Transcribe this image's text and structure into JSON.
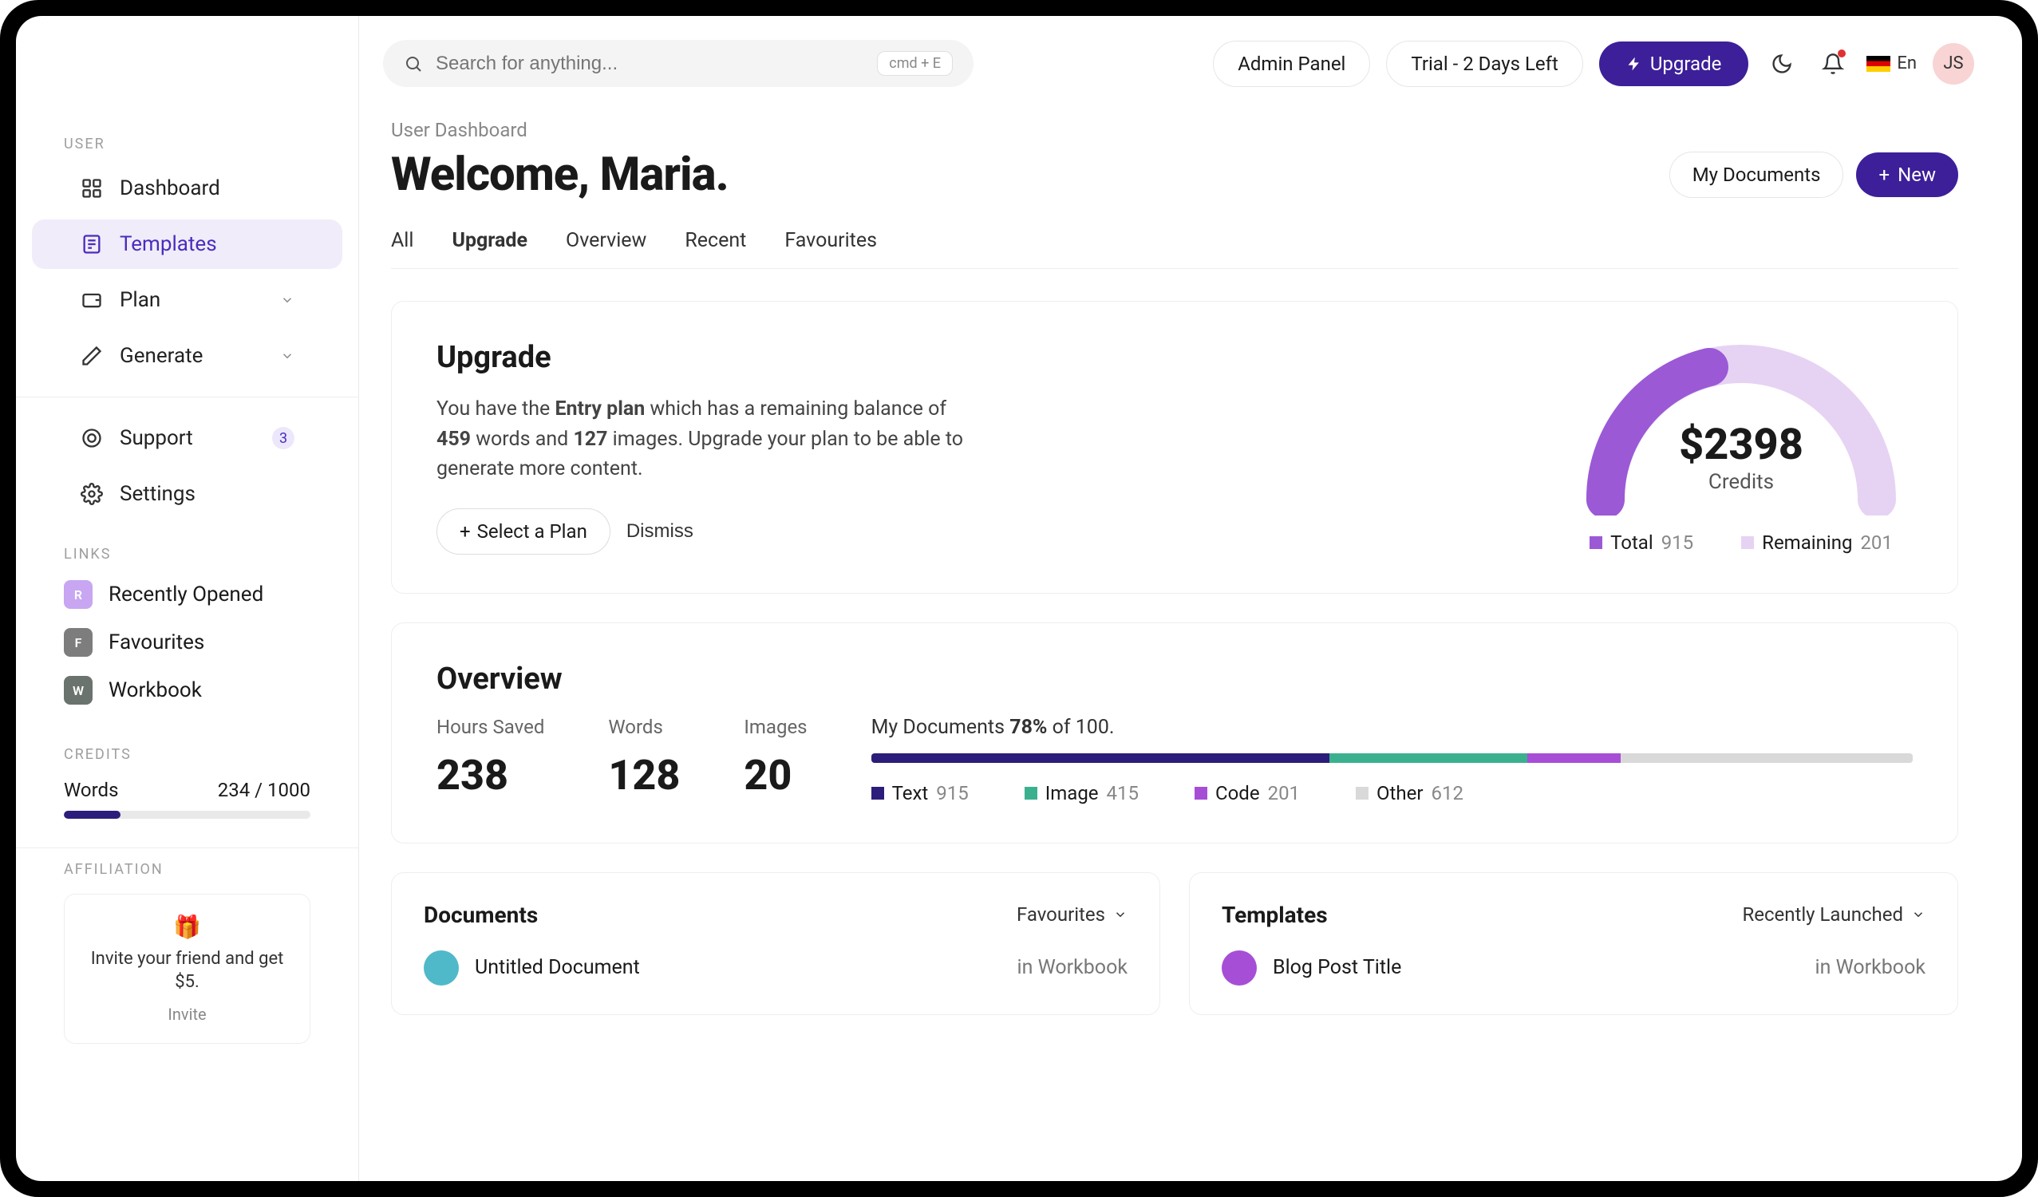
{
  "header": {
    "search_placeholder": "Search for anything...",
    "kbd": "cmd + E",
    "admin_panel": "Admin Panel",
    "trial": "Trial - 2 Days Left",
    "upgrade": "Upgrade",
    "lang": "En",
    "avatar_initials": "JS"
  },
  "sidebar": {
    "user_label": "USER",
    "items": [
      {
        "label": "Dashboard"
      },
      {
        "label": "Templates"
      },
      {
        "label": "Plan"
      },
      {
        "label": "Generate"
      }
    ],
    "support": {
      "label": "Support",
      "badge": "3"
    },
    "settings": {
      "label": "Settings"
    },
    "links_label": "LINKS",
    "links": [
      {
        "label": "Recently Opened",
        "avatar": "R",
        "color": "#c8a6f2"
      },
      {
        "label": "Favourites",
        "avatar": "F",
        "color": "#7d7d7d"
      },
      {
        "label": "Workbook",
        "avatar": "W",
        "color": "#6a736d"
      }
    ],
    "credits_label": "CREDITS",
    "credits_name": "Words",
    "credits_used": "234 / 1000",
    "credits_pct": 23,
    "affil_label": "AFFILIATION",
    "affil_msg": "Invite your friend and get $5.",
    "affil_cta": "Invite"
  },
  "page": {
    "breadcrumb": "User Dashboard",
    "welcome": "Welcome, Maria.",
    "mydocs": "My Documents",
    "new": "New",
    "tabs": [
      "All",
      "Upgrade",
      "Overview",
      "Recent",
      "Favourites"
    ],
    "active_tab": 1
  },
  "upgrade": {
    "title": "Upgrade",
    "text_pre": "You have the ",
    "plan": "Entry plan",
    "text_mid": " which has a remaining balance of ",
    "words": "459",
    "text_mid2": " words and ",
    "images": "127",
    "text_post": " images. Upgrade your plan to be able to generate more content.",
    "select_plan": "Select a Plan",
    "dismiss": "Dismiss",
    "gauge_value": "$2398",
    "gauge_label": "Credits",
    "legend_total": "Total",
    "legend_total_val": "915",
    "legend_remaining": "Remaining",
    "legend_remaining_val": "201"
  },
  "overview": {
    "title": "Overview",
    "stats": [
      {
        "label": "Hours Saved",
        "value": "238"
      },
      {
        "label": "Words",
        "value": "128"
      },
      {
        "label": "Images",
        "value": "20"
      }
    ],
    "docs_text_pre": "My Documents ",
    "docs_pct": "78%",
    "docs_text_post": " of 100.",
    "segments": [
      {
        "name": "Text",
        "val": "915",
        "color": "#2c1d7a",
        "width": 44
      },
      {
        "name": "Image",
        "val": "415",
        "color": "#3bb08f",
        "width": 19
      },
      {
        "name": "Code",
        "val": "201",
        "color": "#a64fd6",
        "width": 9
      },
      {
        "name": "Other",
        "val": "612",
        "color": "#d9d9d9",
        "width": 28
      }
    ]
  },
  "documents": {
    "title": "Documents",
    "filter": "Favourites",
    "item_title": "Untitled Document",
    "item_meta": "in Workbook",
    "item_color": "#4fb9c9"
  },
  "templates": {
    "title": "Templates",
    "filter": "Recently Launched",
    "item_title": "Blog Post Title",
    "item_meta": "in Workbook",
    "item_color": "#a64fd6"
  },
  "chart_data": {
    "type": "pie",
    "title": "Credits",
    "series": [
      {
        "name": "Total",
        "value": 915
      },
      {
        "name": "Remaining",
        "value": 201
      }
    ],
    "center_value": "$2398"
  }
}
